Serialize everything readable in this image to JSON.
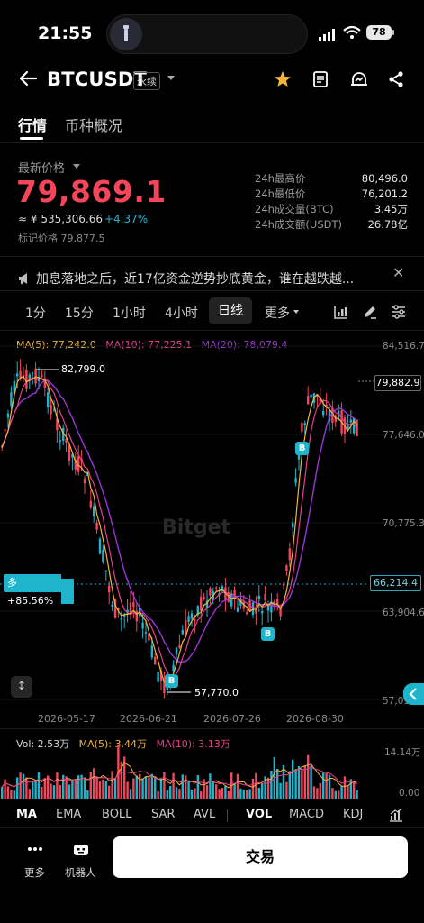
{
  "status_bar": {
    "time": "21:55",
    "battery": "78"
  },
  "header": {
    "pair": "BTCUSDT",
    "contract_type": "永续"
  },
  "tabs": {
    "active": "行情",
    "second": "币种概况"
  },
  "price": {
    "latest_label": "最新价格",
    "last": "79,869.1",
    "cny": "≈ ¥ 535,306.66",
    "change": "+4.37%",
    "mark_price": "标记价格 79,877.5"
  },
  "stats": [
    {
      "label": "24h最高价",
      "value": "80,496.0"
    },
    {
      "label": "24h最低价",
      "value": "76,201.2"
    },
    {
      "label": "24h成交量(BTC)",
      "value": "3.45万"
    },
    {
      "label": "24h成交额(USDT)",
      "value": "26.78亿"
    }
  ],
  "news": {
    "text": "加息落地之后，近17亿资金逆势抄底黄金，谁在越跌越..."
  },
  "timeframes": {
    "t1": "1分",
    "t2": "15分",
    "t3": "1小时",
    "t4": "4小时",
    "active": "日线",
    "more": "更多"
  },
  "chart": {
    "ma5": "MA(5): 77,242.0",
    "ma10": "MA(10): 77,225.1",
    "ma20": "MA(20): 78,079.4",
    "axis": [
      "84,516.7",
      "77,646.0",
      "70,775.3",
      "63,904.6",
      "57,03..."
    ],
    "current_price_tag": "79,882.9",
    "position_price_tag": "66,214.4",
    "position_badge": "多+85.56%",
    "high_label": "82,799.0",
    "low_label": "57,770.0",
    "buy_mark": "B",
    "watermark": "Bitget",
    "dates": [
      "2026-05-17",
      "2026-06-21",
      "2026-07-26",
      "2026-08-30"
    ],
    "colors": {
      "up": "#1eb5cc",
      "down": "#f4465b",
      "ma5": "#f2b43b",
      "ma10": "#e8408a",
      "ma20": "#9a36d6"
    }
  },
  "volume": {
    "vol": "Vol: 2.53万",
    "ma5": "MA(5): 3.44万",
    "ma10": "MA(10): 3.13万",
    "axis_top": "14.14万",
    "axis_bottom": "0.00"
  },
  "indicators": {
    "i1": "MA",
    "i2": "EMA",
    "i3": "BOLL",
    "i4": "SAR",
    "i5": "AVL",
    "i6": "VOL",
    "i7": "MACD",
    "i8": "KDJ"
  },
  "bottom": {
    "more": "更多",
    "robot": "机器人",
    "trade": "交易"
  }
}
